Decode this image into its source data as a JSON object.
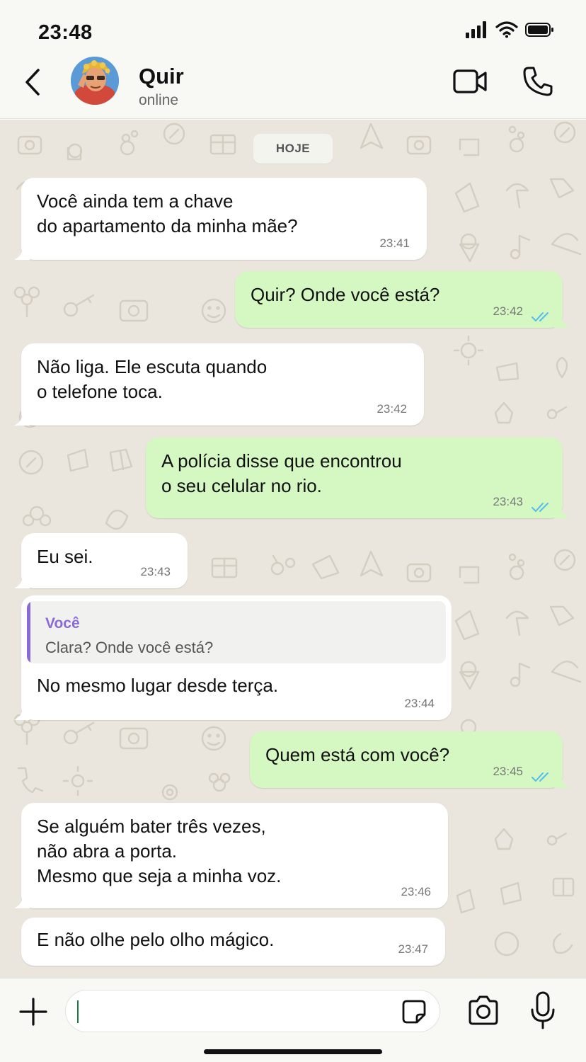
{
  "status_bar": {
    "time": "23:48"
  },
  "header": {
    "contact_name": "Quir",
    "contact_status": "online"
  },
  "chat": {
    "day_label": "HOJE",
    "messages": [
      {
        "direction": "in",
        "text": "Você ainda tem a chave\ndo apartamento da minha mãe?",
        "time": "23:41"
      },
      {
        "direction": "out",
        "text": "Quir? Onde você está?",
        "time": "23:42",
        "status": "read"
      },
      {
        "direction": "in",
        "text": "Não liga. Ele escuta quando\no telefone toca.",
        "time": "23:42"
      },
      {
        "direction": "out",
        "text": "A polícia disse que encontrou\no seu celular no rio.",
        "time": "23:43",
        "status": "read"
      },
      {
        "direction": "in",
        "text": "Eu sei.",
        "time": "23:43"
      },
      {
        "direction": "in",
        "text": "No mesmo lugar desde terça.",
        "time": "23:44",
        "reply": {
          "author": "Você",
          "text": "Clara? Onde você está?"
        }
      },
      {
        "direction": "out",
        "text": "Quem está com você?",
        "time": "23:45",
        "status": "read"
      },
      {
        "direction": "in",
        "text": "Se alguém bater três vezes,\nnão abra a porta.\nMesmo que seja a minha voz.",
        "time": "23:46"
      },
      {
        "direction": "in",
        "text": "E não olhe pelo olho mágico.",
        "time": "23:47"
      }
    ]
  },
  "input": {
    "placeholder": ""
  },
  "colors": {
    "outgoing_bubble": "#d5f8c2",
    "incoming_bubble": "#ffffff",
    "chat_background": "#ebe6dd",
    "read_ticks": "#53bdeb",
    "reply_accent": "#8a6ad7"
  },
  "icons": {
    "back": "chevron-left-icon",
    "video": "video-camera-icon",
    "call": "phone-icon",
    "attach": "plus-icon",
    "sticker": "sticker-icon",
    "camera": "camera-icon",
    "mic": "microphone-icon"
  }
}
